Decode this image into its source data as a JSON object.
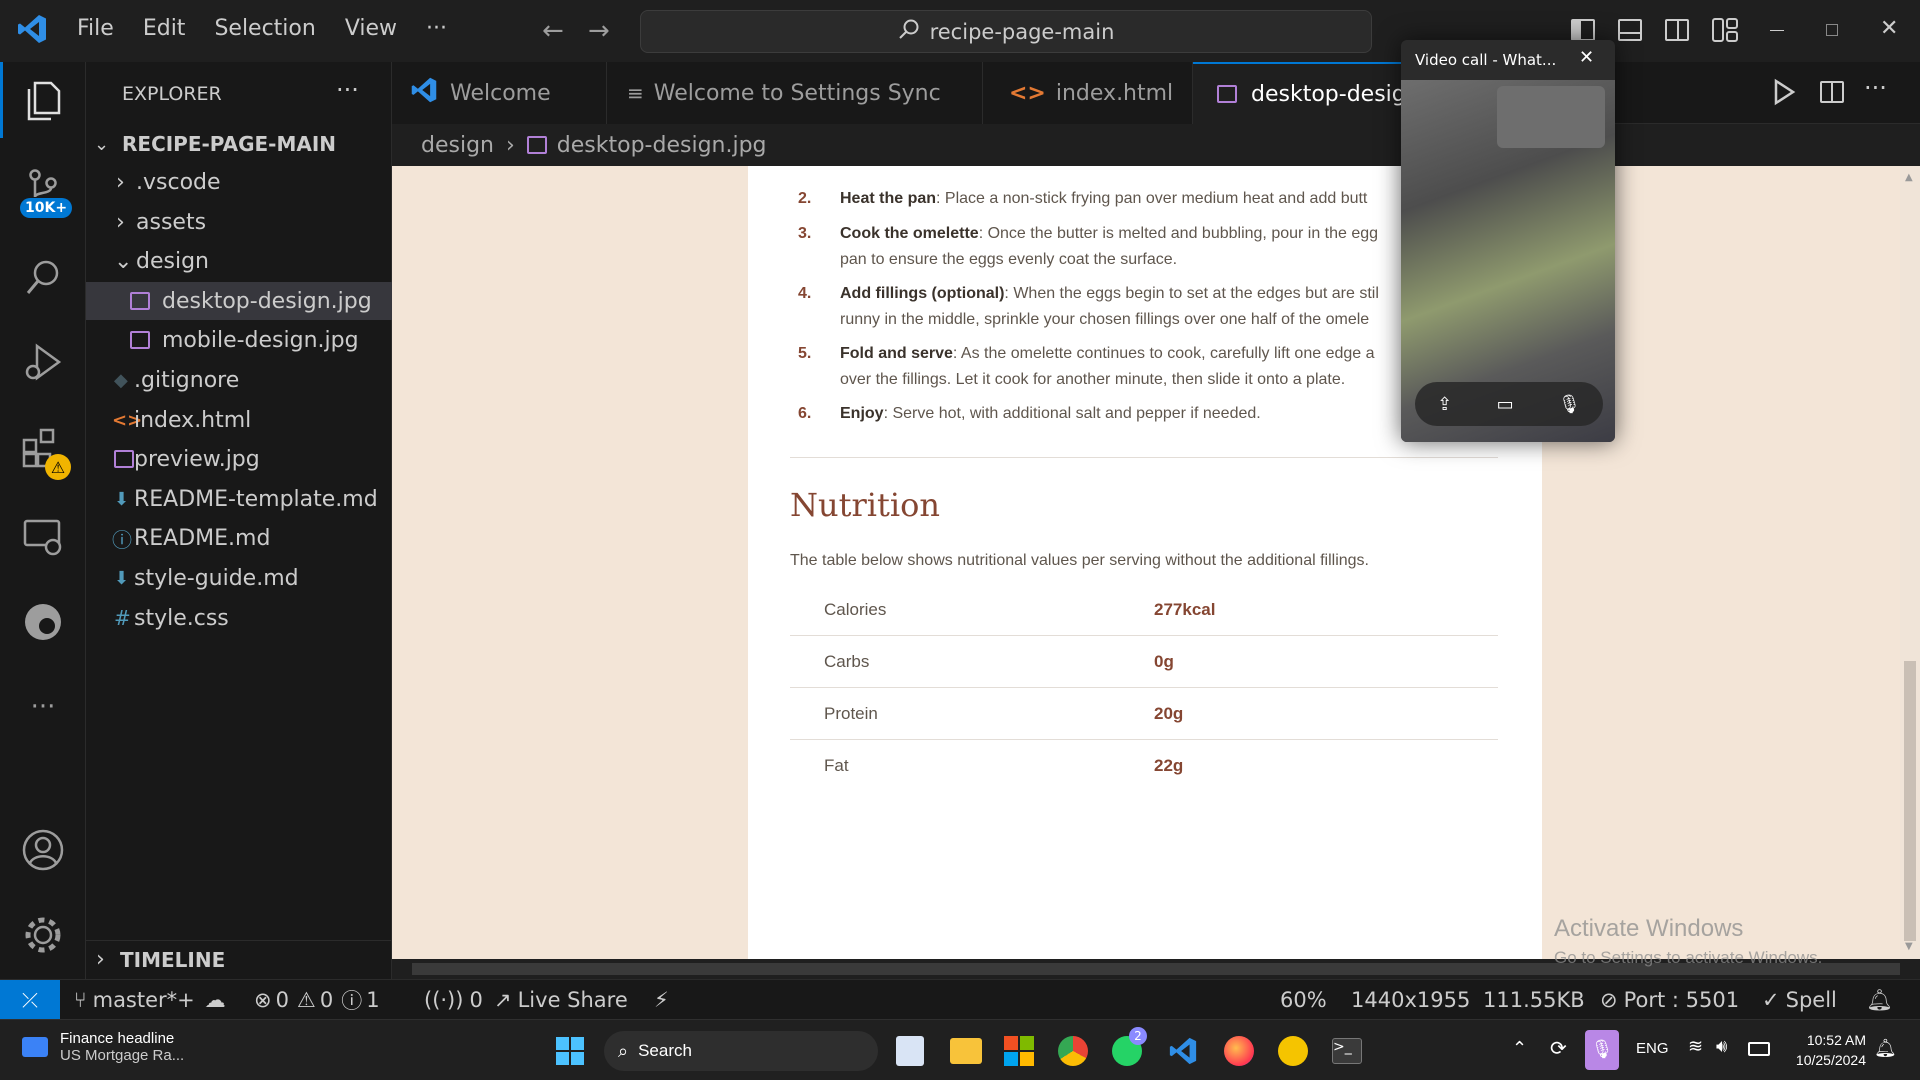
{
  "titlebar": {
    "menu": [
      "File",
      "Edit",
      "Selection",
      "View",
      "···"
    ],
    "search_text": "recipe-page-main"
  },
  "activitybar": {
    "badge": "10K+"
  },
  "sidebar": {
    "title": "EXPLORER",
    "more": "···",
    "root": "RECIPE-PAGE-MAIN",
    "items": [
      {
        "label": ".vscode",
        "icon": "chevron-right-icon"
      },
      {
        "label": "assets",
        "icon": "chevron-right-icon"
      },
      {
        "label": "design",
        "icon": "chevron-down-icon"
      },
      {
        "label": "desktop-design.jpg",
        "icon": "image-icon"
      },
      {
        "label": "mobile-design.jpg",
        "icon": "image-icon"
      },
      {
        "label": ".gitignore",
        "icon": "git-icon"
      },
      {
        "label": "index.html",
        "icon": "html-icon"
      },
      {
        "label": "preview.jpg",
        "icon": "image-icon"
      },
      {
        "label": "README-template.md",
        "icon": "markdown-icon"
      },
      {
        "label": "README.md",
        "icon": "info-icon"
      },
      {
        "label": "style-guide.md",
        "icon": "markdown-icon"
      },
      {
        "label": "style.css",
        "icon": "css-icon"
      }
    ],
    "timeline": "TIMELINE"
  },
  "tabs": [
    {
      "label": "Welcome"
    },
    {
      "label": "Welcome to Settings Sync"
    },
    {
      "label": "index.html"
    },
    {
      "label": "desktop-desig"
    }
  ],
  "breadcrumb": {
    "folder": "design",
    "file": "desktop-design.jpg"
  },
  "recipe": {
    "steps": [
      {
        "num": "2.",
        "bold": "Heat the pan",
        "text": ": Place a non-stick frying pan over medium heat and add butt"
      },
      {
        "num": "3.",
        "bold": "Cook the omelette",
        "text": ": Once the butter is melted and bubbling, pour in the egg",
        "line2": "pan to ensure the eggs evenly coat the surface."
      },
      {
        "num": "4.",
        "bold": "Add fillings (optional)",
        "text": ": When the eggs begin to set at the edges but are stil",
        "line2": "runny in the middle, sprinkle your chosen fillings over one half of the omele"
      },
      {
        "num": "5.",
        "bold": "Fold and serve",
        "text": ": As the omelette continues to cook, carefully lift one edge a",
        "line2": "over the fillings. Let it cook for another minute, then slide it onto a plate."
      },
      {
        "num": "6.",
        "bold": "Enjoy",
        "text": ": Serve hot, with additional salt and pepper if needed."
      }
    ],
    "nutrition_title": "Nutrition",
    "nutrition_desc": "The table below shows nutritional values per serving without the additional fillings.",
    "nutrition": [
      {
        "label": "Calories",
        "value": "277kcal"
      },
      {
        "label": "Carbs",
        "value": "0g"
      },
      {
        "label": "Protein",
        "value": "20g"
      },
      {
        "label": "Fat",
        "value": "22g"
      }
    ]
  },
  "watermark": {
    "line1": "Activate Windows",
    "line2": "Go to Settings to activate Windows."
  },
  "statusbar": {
    "branch": "master*+",
    "errors": "0",
    "warnings": "0",
    "infos": "1",
    "ports": "0",
    "live_share": "Live Share",
    "zoom": "60%",
    "dimensions": "1440x1955",
    "filesize": "111.55KB",
    "port": "Port : 5501",
    "spell": "Spell"
  },
  "video_call": {
    "title": "Video call - What..."
  },
  "taskbar": {
    "news_title": "Finance headline",
    "news_sub": "US Mortgage Ra...",
    "search": "Search",
    "whatsapp_badge": "2",
    "lang": "ENG",
    "time": "10:52 AM",
    "date": "10/25/2024"
  },
  "colors": {
    "accent": "#0078d4",
    "recipe_brown": "#854632",
    "recipe_bg": "#f3e5d7",
    "remote_blue": "#0078d4"
  }
}
